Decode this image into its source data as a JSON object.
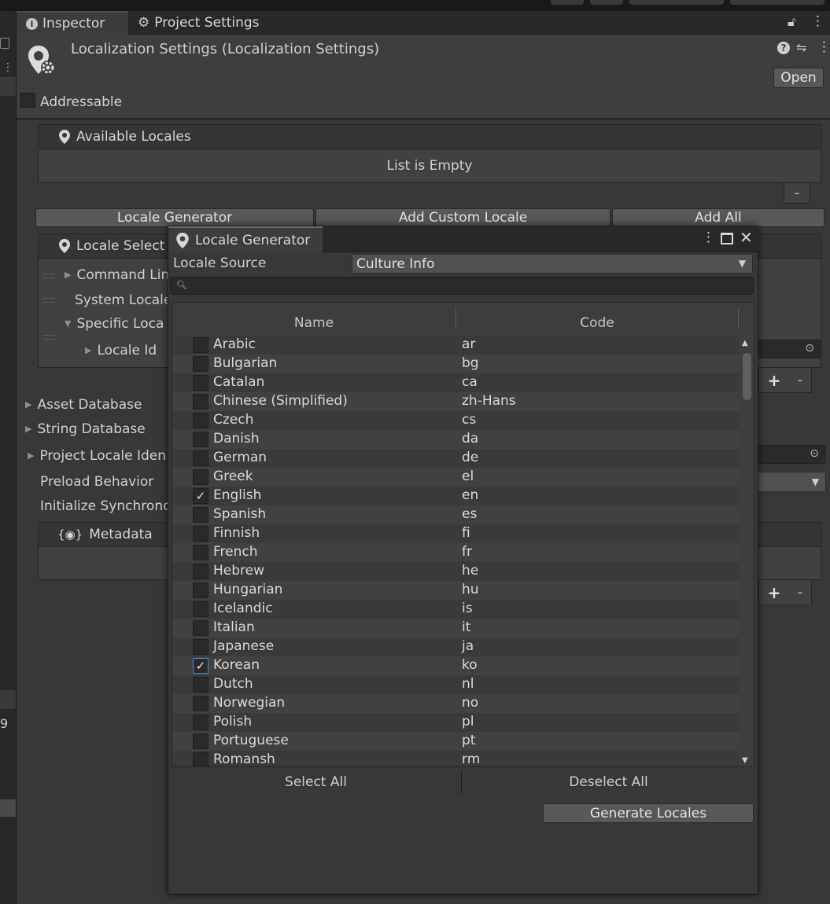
{
  "tabs": [
    {
      "label": "Inspector",
      "icon": "info-icon"
    },
    {
      "label": "Project Settings",
      "icon": "gear-icon"
    }
  ],
  "header": {
    "title": "Localization Settings (Localization Settings)",
    "open_label": "Open",
    "addressable_label": "Addressable"
  },
  "available_locales": {
    "title": "Available Locales",
    "empty_text": "List is Empty",
    "minus": "-"
  },
  "buttons": {
    "locale_generator": "Locale Generator",
    "add_custom_locale": "Add Custom Locale",
    "add_all": "Add All"
  },
  "locale_selectors": {
    "title": "Locale Select",
    "items": [
      "Command Lin",
      "System Locale",
      "Specific Loca",
      "Locale Id"
    ]
  },
  "settings_rows": {
    "asset_database": "Asset Database",
    "string_database": "String Database",
    "project_locale": "Project Locale Iden",
    "preload_behavior": "Preload Behavior",
    "initialize_sync": "Initialize Synchrono",
    "metadata": "Metadata",
    "plus": "+",
    "minus": "-",
    "left_edge_number": "9"
  },
  "popup": {
    "title": "Locale Generator",
    "locale_source_label": "Locale Source",
    "locale_source_value": "Culture Info",
    "columns": {
      "name": "Name",
      "code": "Code"
    },
    "rows": [
      {
        "name": "Arabic",
        "code": "ar",
        "checked": false
      },
      {
        "name": "Bulgarian",
        "code": "bg",
        "checked": false
      },
      {
        "name": "Catalan",
        "code": "ca",
        "checked": false
      },
      {
        "name": "Chinese (Simplified)",
        "code": "zh-Hans",
        "checked": false
      },
      {
        "name": "Czech",
        "code": "cs",
        "checked": false
      },
      {
        "name": "Danish",
        "code": "da",
        "checked": false
      },
      {
        "name": "German",
        "code": "de",
        "checked": false
      },
      {
        "name": "Greek",
        "code": "el",
        "checked": false
      },
      {
        "name": "English",
        "code": "en",
        "checked": true
      },
      {
        "name": "Spanish",
        "code": "es",
        "checked": false
      },
      {
        "name": "Finnish",
        "code": "fi",
        "checked": false
      },
      {
        "name": "French",
        "code": "fr",
        "checked": false
      },
      {
        "name": "Hebrew",
        "code": "he",
        "checked": false
      },
      {
        "name": "Hungarian",
        "code": "hu",
        "checked": false
      },
      {
        "name": "Icelandic",
        "code": "is",
        "checked": false
      },
      {
        "name": "Italian",
        "code": "it",
        "checked": false
      },
      {
        "name": "Japanese",
        "code": "ja",
        "checked": false
      },
      {
        "name": "Korean",
        "code": "ko",
        "checked": true,
        "focused": true
      },
      {
        "name": "Dutch",
        "code": "nl",
        "checked": false
      },
      {
        "name": "Norwegian",
        "code": "no",
        "checked": false
      },
      {
        "name": "Polish",
        "code": "pl",
        "checked": false
      },
      {
        "name": "Portuguese",
        "code": "pt",
        "checked": false
      },
      {
        "name": "Romansh",
        "code": "rm",
        "checked": false
      }
    ],
    "select_all": "Select All",
    "deselect_all": "Deselect All",
    "generate_locales": "Generate Locales"
  }
}
